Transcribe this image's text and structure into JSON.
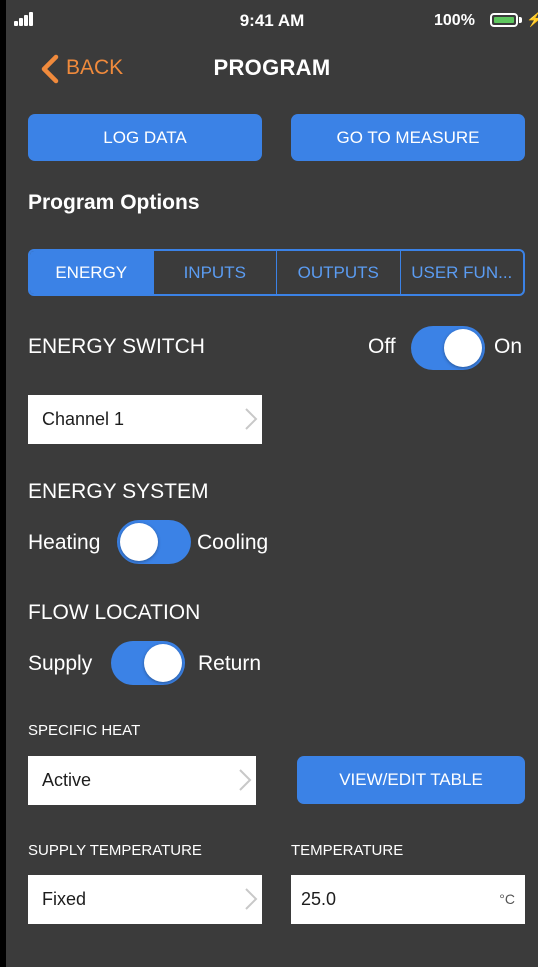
{
  "status": {
    "time": "9:41 AM",
    "battery": "100%",
    "battery_fill": 1.0
  },
  "nav": {
    "back_label": "BACK",
    "title": "PROGRAM"
  },
  "actions": {
    "log_data": "LOG DATA",
    "go_to_measure": "GO TO MEASURE"
  },
  "section_title": "Program Options",
  "tabs": [
    {
      "label": "ENERGY",
      "active": true
    },
    {
      "label": "INPUTS",
      "active": false
    },
    {
      "label": "OUTPUTS",
      "active": false
    },
    {
      "label": "USER FUN...",
      "active": false
    }
  ],
  "energy_switch": {
    "label": "ENERGY SWITCH",
    "off_label": "Off",
    "on_label": "On",
    "state": "On"
  },
  "channel": {
    "value": "Channel 1"
  },
  "energy_system": {
    "label": "ENERGY SYSTEM",
    "left_label": "Heating",
    "right_label": "Cooling",
    "state": "Heating"
  },
  "flow_location": {
    "label": "FLOW LOCATION",
    "left_label": "Supply",
    "right_label": "Return",
    "state": "Return"
  },
  "specific_heat": {
    "label": "SPECIFIC HEAT",
    "value": "Active",
    "view_edit_button": "VIEW/EDIT TABLE"
  },
  "supply_temperature": {
    "label": "SUPPLY TEMPERATURE",
    "value": "Fixed"
  },
  "temperature": {
    "label": "TEMPERATURE",
    "value": "25.0",
    "unit": "°C"
  },
  "colors": {
    "accent": "#3b82e6",
    "back": "#f08a3c",
    "background": "#3b3b3b"
  }
}
